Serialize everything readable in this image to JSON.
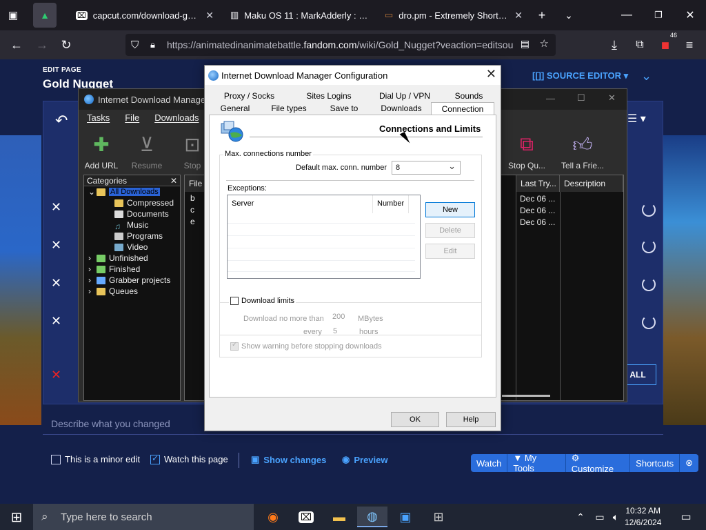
{
  "browser": {
    "tabs": [
      {
        "label": "",
        "icon": "triangle-app-icon"
      },
      {
        "label": "capcut.com/download-guidan",
        "icon": "capcut-icon"
      },
      {
        "label": "Maku OS 11 : MarkAdderly : Fre",
        "icon": "archive-icon"
      },
      {
        "label": "dro.pm - Extremely Short Links",
        "icon": "dro-icon"
      }
    ],
    "url_prefix": "https://animatedinanimatebattle.",
    "url_host": "fandom.com",
    "url_path": "/wiki/Gold_Nugget?veaction=editsou",
    "extension_badge": "46"
  },
  "wiki": {
    "edit_label": "EDIT PAGE",
    "page_title": "Gold Nugget",
    "source_editor": "[[]] SOURCE EDITOR ▾",
    "describe_placeholder": "Describe what you changed",
    "minor_edit": "This is a minor edit",
    "watch_page": "Watch this page",
    "show_changes": "Show changes",
    "preview": "Preview",
    "all_button": "ALL",
    "toolbar": [
      "Watch",
      "▼ My Tools",
      "⚙ Customize",
      "Shortcuts"
    ]
  },
  "idm": {
    "title": "Internet Download Manager",
    "menu": [
      "Tasks",
      "File",
      "Downloads"
    ],
    "tools": [
      "Add URL",
      "Resume",
      "Stop",
      "Stop Qu...",
      "Tell a Frie..."
    ],
    "categories_header": "Categories",
    "categories": [
      {
        "label": "All Downloads",
        "level": 0,
        "selected": true
      },
      {
        "label": "Compressed",
        "level": 1
      },
      {
        "label": "Documents",
        "level": 1
      },
      {
        "label": "Music",
        "level": 1
      },
      {
        "label": "Programs",
        "level": 1
      },
      {
        "label": "Video",
        "level": 1
      },
      {
        "label": "Unfinished",
        "level": 0
      },
      {
        "label": "Finished",
        "level": 0
      },
      {
        "label": "Grabber projects",
        "level": 0
      },
      {
        "label": "Queues",
        "level": 0
      }
    ],
    "file_col": "File N",
    "file_rows": [
      "b",
      "c",
      "e"
    ],
    "last_try_col": "Last Try...",
    "description_col": "Description",
    "last_try_values": [
      "Dec 06 ...",
      "Dec 06 ...",
      "Dec 06 ..."
    ]
  },
  "dialog": {
    "title": "Internet Download Manager Configuration",
    "tabs_row1": [
      "Proxy / Socks",
      "Sites Logins",
      "Dial Up / VPN",
      "Sounds"
    ],
    "tabs_row2": [
      "General",
      "File types",
      "Save to",
      "Downloads",
      "Connection"
    ],
    "section_title": "Connections and Limits",
    "max_conn_group": "Max. connections number",
    "default_max_label": "Default max. conn. number",
    "default_max_value": "8",
    "exceptions_label": "Exceptions:",
    "col_server": "Server",
    "col_number": "Number",
    "btn_new": "New",
    "btn_delete": "Delete",
    "btn_edit": "Edit",
    "download_limits": "Download limits",
    "no_more_than": "Download no more than",
    "limit_value": "200",
    "limit_unit": "MBytes",
    "every": "every",
    "every_value": "5",
    "every_unit": "hours",
    "show_warning": "Show warning before stopping downloads",
    "ok": "OK",
    "help": "Help"
  },
  "taskbar": {
    "search_placeholder": "Type here to search",
    "time": "10:32 AM",
    "date": "12/6/2024"
  }
}
